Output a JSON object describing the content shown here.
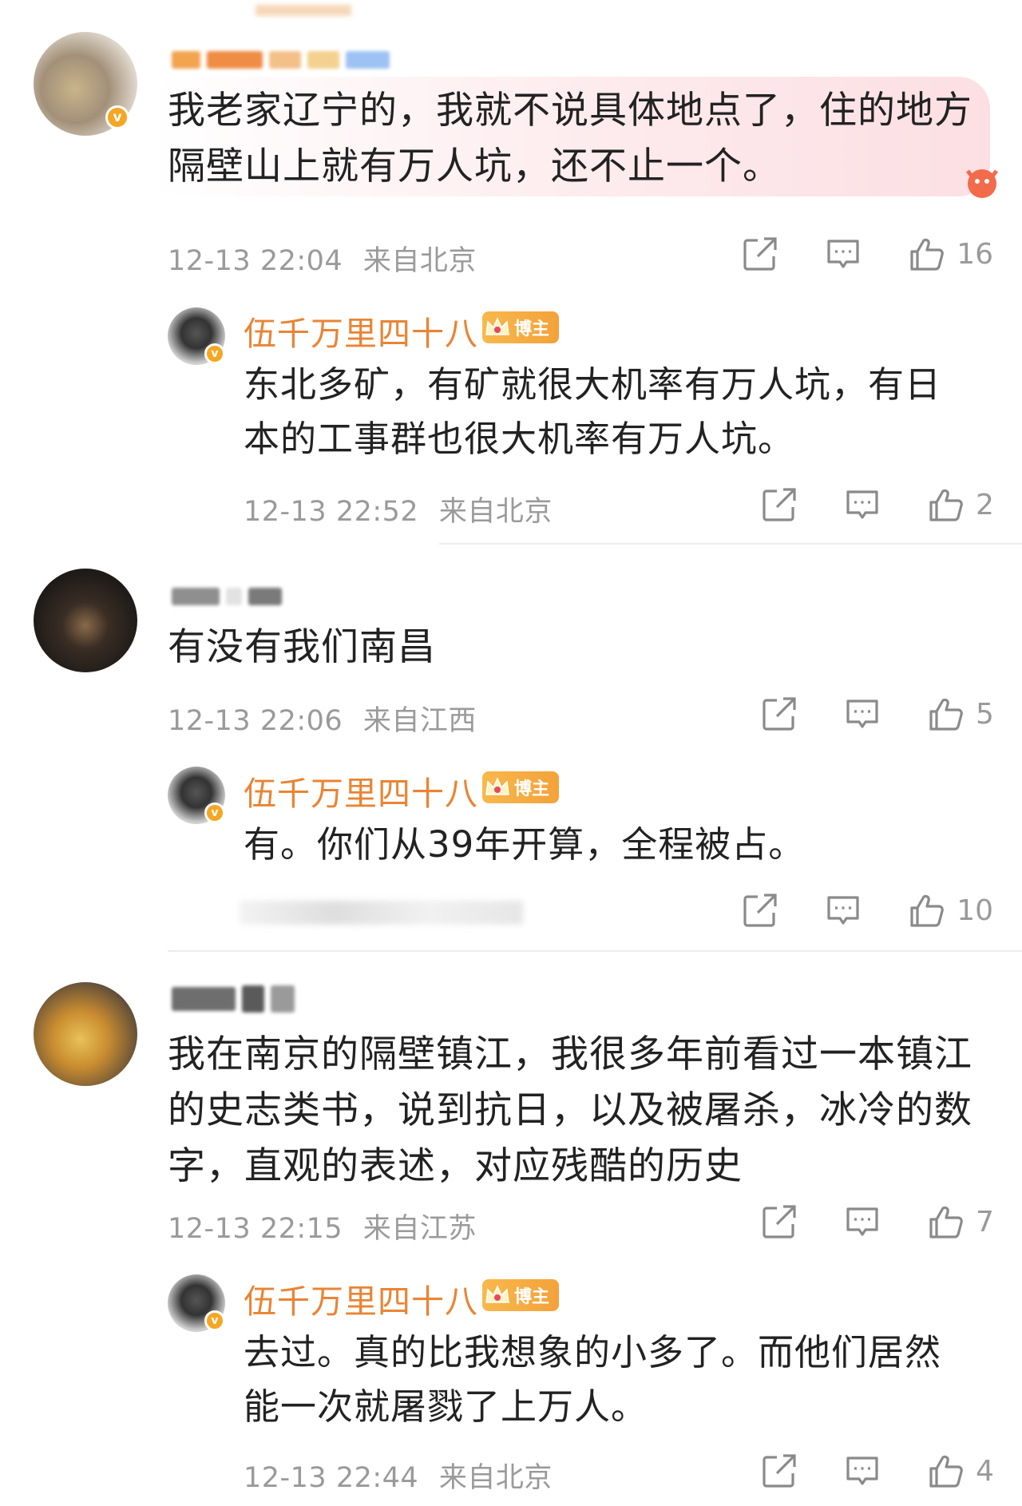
{
  "colors": {
    "author_name": "#e98434",
    "meta_gray": "#9a9a9a",
    "badge_orange": "#f3a23a",
    "text": "#222222"
  },
  "comments": [
    {
      "text_lines": [
        "我老家辽宁的，我就不说具体地点了，住的地方",
        "隔壁山上就有万人坑，还不止一个。"
      ],
      "time": "12-13 22:04",
      "location": "来自北京",
      "likes": "16",
      "reply": {
        "name": "伍千万里四十八",
        "badge": "博主",
        "text_lines": [
          "东北多矿，有矿就很大机率有万人坑，有日",
          "本的工事群也很大机率有万人坑。"
        ],
        "time": "12-13 22:52",
        "location": "来自北京",
        "likes": "2"
      }
    },
    {
      "text_lines": [
        "有没有我们南昌"
      ],
      "time": "12-13 22:06",
      "location": "来自江西",
      "likes": "5",
      "reply": {
        "name": "伍千万里四十八",
        "badge": "博主",
        "text_lines": [
          "有。你们从39年开算，全程被占。"
        ],
        "likes": "10"
      }
    },
    {
      "text_lines": [
        "我在南京的隔壁镇江，我很多年前看过一本镇江",
        "的史志类书，说到抗日，以及被屠杀，冰冷的数",
        "字，直观的表述，对应残酷的历史"
      ],
      "time": "12-13 22:15",
      "location": "来自江苏",
      "likes": "7",
      "reply": {
        "name": "伍千万里四十八",
        "badge": "博主",
        "text_lines": [
          "去过。真的比我想象的小多了。而他们居然",
          "能一次就屠戮了上万人。"
        ],
        "time": "12-13 22:44",
        "location": "来自北京",
        "likes": "4"
      }
    }
  ],
  "icons": {
    "share": "share-icon",
    "comment": "comment-icon",
    "like": "thumbs-up-icon",
    "verified": "verified-v-icon",
    "crown": "crown-icon"
  }
}
